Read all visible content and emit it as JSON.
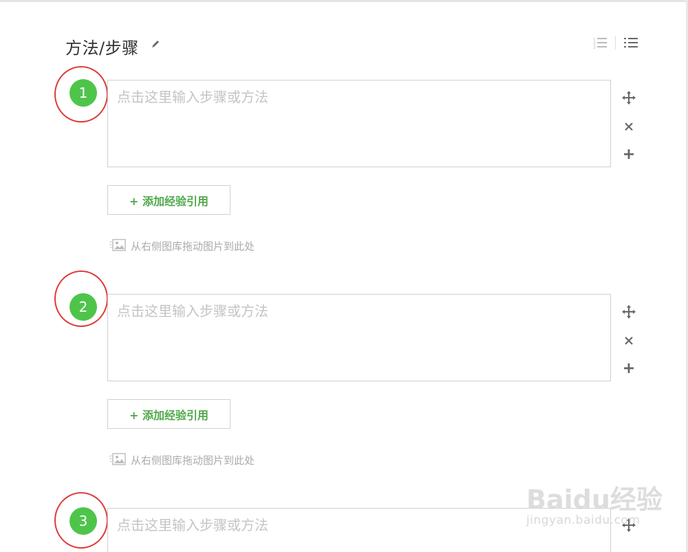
{
  "section": {
    "title": "方法/步骤"
  },
  "steps": [
    {
      "number": "1",
      "placeholder": "点击这里输入步骤或方法",
      "quote_label": "+ 添加经验引用",
      "drop_hint": "从右侧图库拖动图片到此处"
    },
    {
      "number": "2",
      "placeholder": "点击这里输入步骤或方法",
      "quote_label": "+ 添加经验引用",
      "drop_hint": "从右侧图库拖动图片到此处"
    },
    {
      "number": "3",
      "placeholder": "点击这里输入步骤或方法"
    }
  ],
  "watermark": {
    "main": "Baidu经验",
    "sub": "jingyan.baidu.com"
  },
  "colors": {
    "step_badge": "#4ec54a",
    "annotation_ring": "#e03a3a",
    "quote_text": "#4fa84a"
  },
  "icons": [
    "edit-icon",
    "numbered-list-icon",
    "bullet-list-icon",
    "move-icon",
    "close-icon",
    "plus-icon",
    "image-icon"
  ]
}
